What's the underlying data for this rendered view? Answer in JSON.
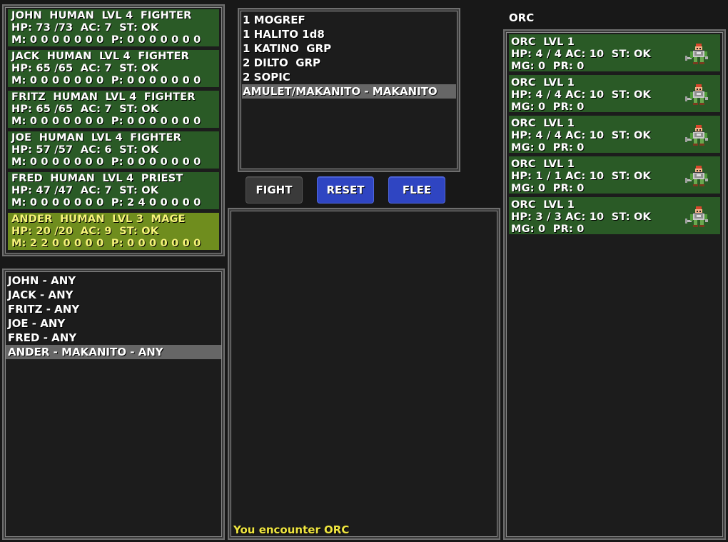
{
  "party": [
    {
      "line1": "JOHN  HUMAN  LVL 4  FIGHTER",
      "line2": "HP: 73 /73  AC: 7  ST: OK",
      "line3": "M: 0 0 0 0 0 0 0  P: 0 0 0 0 0 0 0"
    },
    {
      "line1": "JACK  HUMAN  LVL 4  FIGHTER",
      "line2": "HP: 65 /65  AC: 7  ST: OK",
      "line3": "M: 0 0 0 0 0 0 0  P: 0 0 0 0 0 0 0"
    },
    {
      "line1": "FRITZ  HUMAN  LVL 4  FIGHTER",
      "line2": "HP: 65 /65  AC: 7  ST: OK",
      "line3": "M: 0 0 0 0 0 0 0  P: 0 0 0 0 0 0 0"
    },
    {
      "line1": "JOE  HUMAN  LVL 4  FIGHTER",
      "line2": "HP: 57 /57  AC: 6  ST: OK",
      "line3": "M: 0 0 0 0 0 0 0  P: 0 0 0 0 0 0 0"
    },
    {
      "line1": "FRED  HUMAN  LVL 4  PRIEST",
      "line2": "HP: 47 /47  AC: 7  ST: OK",
      "line3": "M: 0 0 0 0 0 0 0  P: 2 4 0 0 0 0 0"
    },
    {
      "line1": "ANDER  HUMAN  LVL 3  MAGE",
      "line2": "HP: 20 /20  AC: 9  ST: OK",
      "line3": "M: 2 2 0 0 0 0 0  P: 0 0 0 0 0 0 0"
    }
  ],
  "spells": [
    "1 MOGREF",
    "1 HALITO 1d8",
    "1 KATINO  GRP",
    "2 DILTO  GRP",
    "2 SOPIC",
    "AMULET/MAKANITO - MAKANITO"
  ],
  "buttons": {
    "fight": "FIGHT",
    "reset": "RESET",
    "flee": "FLEE"
  },
  "actions": [
    "JOHN - ANY",
    "JACK - ANY",
    "FRITZ - ANY",
    "JOE - ANY",
    "FRED - ANY",
    "ANDER - MAKANITO - ANY"
  ],
  "log": {
    "message": "You encounter ORC"
  },
  "enemy_group": {
    "title": "ORC"
  },
  "enemies": [
    {
      "line1": "ORC  LVL 1",
      "line2": "HP: 4 / 4 AC: 10  ST: OK",
      "line3": "MG: 0  PR: 0",
      "icon": "orc-sprite-icon"
    },
    {
      "line1": "ORC  LVL 1",
      "line2": "HP: 4 / 4 AC: 10  ST: OK",
      "line3": "MG: 0  PR: 0",
      "icon": "orc-sprite-icon"
    },
    {
      "line1": "ORC  LVL 1",
      "line2": "HP: 4 / 4 AC: 10  ST: OK",
      "line3": "MG: 0  PR: 0",
      "icon": "orc-sprite-icon"
    },
    {
      "line1": "ORC  LVL 1",
      "line2": "HP: 1 / 1 AC: 10  ST: OK",
      "line3": "MG: 0  PR: 0",
      "icon": "orc-sprite-icon"
    },
    {
      "line1": "ORC  LVL 1",
      "line2": "HP: 3 / 3 AC: 10  ST: OK",
      "line3": "MG: 0  PR: 0",
      "icon": "orc-sprite-icon"
    }
  ],
  "colors": {
    "row_green": "#2a5a26",
    "row_selected": "#6f8d1e",
    "selected_text": "#f6f37a",
    "button_blue": "#2f45c2",
    "log_text": "#f0e640"
  }
}
